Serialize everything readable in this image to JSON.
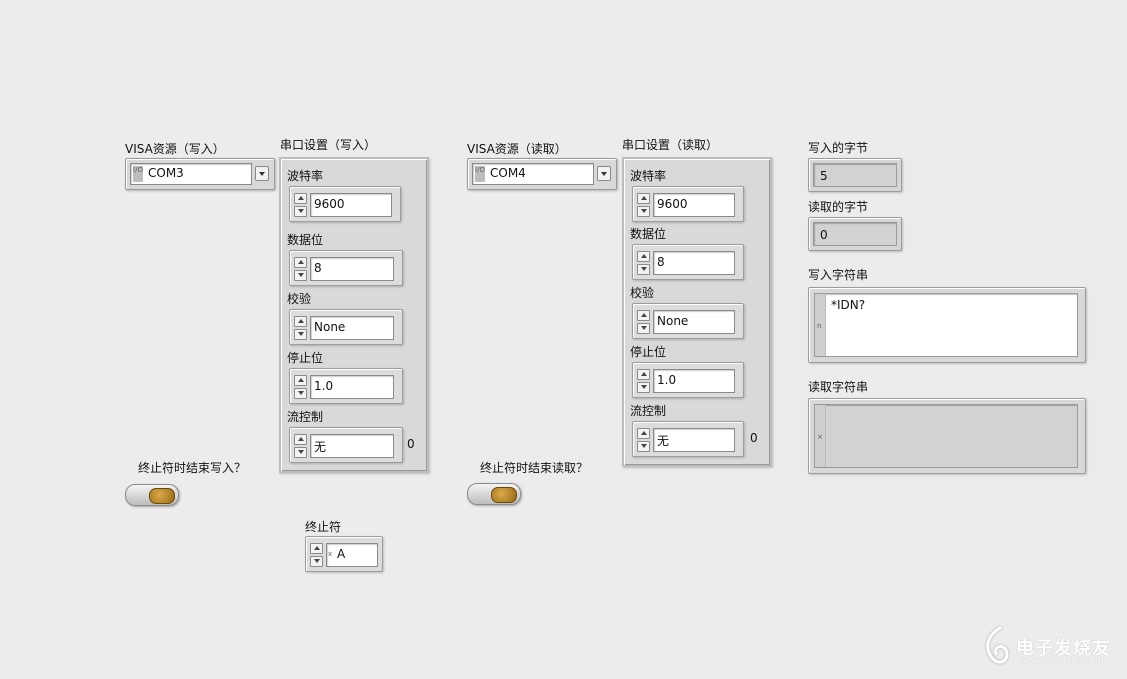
{
  "write": {
    "visa_label": "VISA资源（写入）",
    "visa_value": "COM3",
    "serial_label": "串口设置（写入）",
    "baud_label": "波特率",
    "baud": "9600",
    "data_bits_label": "数据位",
    "data_bits": "8",
    "parity_label": "校验",
    "parity": "None",
    "stop_bits_label": "停止位",
    "stop_bits": "1.0",
    "flow_label": "流控制",
    "flow": "无",
    "flow_num": "0",
    "term_question": "终止符时结束写入？",
    "term_char_label": "终止符",
    "term_char": "A"
  },
  "read": {
    "visa_label": "VISA资源（读取）",
    "visa_value": "COM4",
    "serial_label": "串口设置（读取）",
    "baud_label": "波特率",
    "baud": "9600",
    "data_bits_label": "数据位",
    "data_bits": "8",
    "parity_label": "校验",
    "parity": "None",
    "stop_bits_label": "停止位",
    "stop_bits": "1.0",
    "flow_label": "流控制",
    "flow": "无",
    "flow_num": "0",
    "term_question": "终止符时结束读取？"
  },
  "indicators": {
    "bytes_written_label": "写入的字节",
    "bytes_written": "5",
    "bytes_read_label": "读取的字节",
    "bytes_read": "0",
    "write_string_label": "写入字符串",
    "write_string": "*IDN?",
    "read_string_label": "读取字符串",
    "read_string": ""
  },
  "io_glyph": "I/O",
  "string_display_glyph": "n",
  "read_display_glyph": "×",
  "term_radix_glyph": "x",
  "watermark": {
    "title": "电子发烧友",
    "url": "www.elecfans.com"
  },
  "colors": {
    "background": "#ececec",
    "toggle_knob": "#b98522"
  }
}
